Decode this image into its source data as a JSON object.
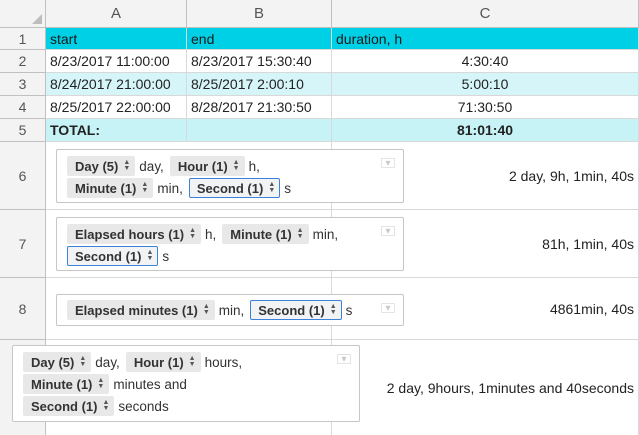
{
  "columns": [
    "A",
    "B",
    "C"
  ],
  "rows": [
    "1",
    "2",
    "3",
    "4",
    "5",
    "6",
    "7",
    "8"
  ],
  "header": {
    "start": "start",
    "end": "end",
    "duration": "duration, h"
  },
  "data_rows": [
    {
      "start": "8/23/2017 11:00:00",
      "end": "8/23/2017 15:30:40",
      "duration": "4:30:40"
    },
    {
      "start": "8/24/2017 21:00:00",
      "end": "8/25/2017 2:00:10",
      "duration": "5:00:10"
    },
    {
      "start": "8/25/2017 22:00:00",
      "end": "8/28/2017 21:30:50",
      "duration": "71:30:50"
    }
  ],
  "total": {
    "label": "TOTAL:",
    "value": "81:01:40"
  },
  "formats": {
    "r6": {
      "day_chip": "Day (5)",
      "day_sep": "day,",
      "hour_chip": "Hour (1)",
      "hour_sep": "h,",
      "minute_chip": "Minute (1)",
      "minute_sep": "min,",
      "second_chip": "Second (1)",
      "second_sep": "s",
      "result": "2 day, 9h, 1min, 40s"
    },
    "r7": {
      "ehours_chip": "Elapsed hours (1)",
      "ehours_sep": "h,",
      "minute_chip": "Minute (1)",
      "minute_sep": "min,",
      "second_chip": "Second (1)",
      "second_sep": "s",
      "result": "81h, 1min, 40s"
    },
    "r8": {
      "emin_chip": "Elapsed minutes (1)",
      "emin_sep": "min,",
      "second_chip": "Second (1)",
      "second_sep": "s",
      "result": "4861min, 40s"
    },
    "r9": {
      "day_chip": "Day (5)",
      "day_sep": "day,",
      "hour_chip": "Hour (1)",
      "hour_sep": "hours,",
      "minute_chip": "Minute (1)",
      "minute_sep": "minutes and",
      "second_chip": "Second (1)",
      "second_sep": "seconds",
      "result": "2 day, 9hours, 1minutes and 40seconds"
    }
  }
}
